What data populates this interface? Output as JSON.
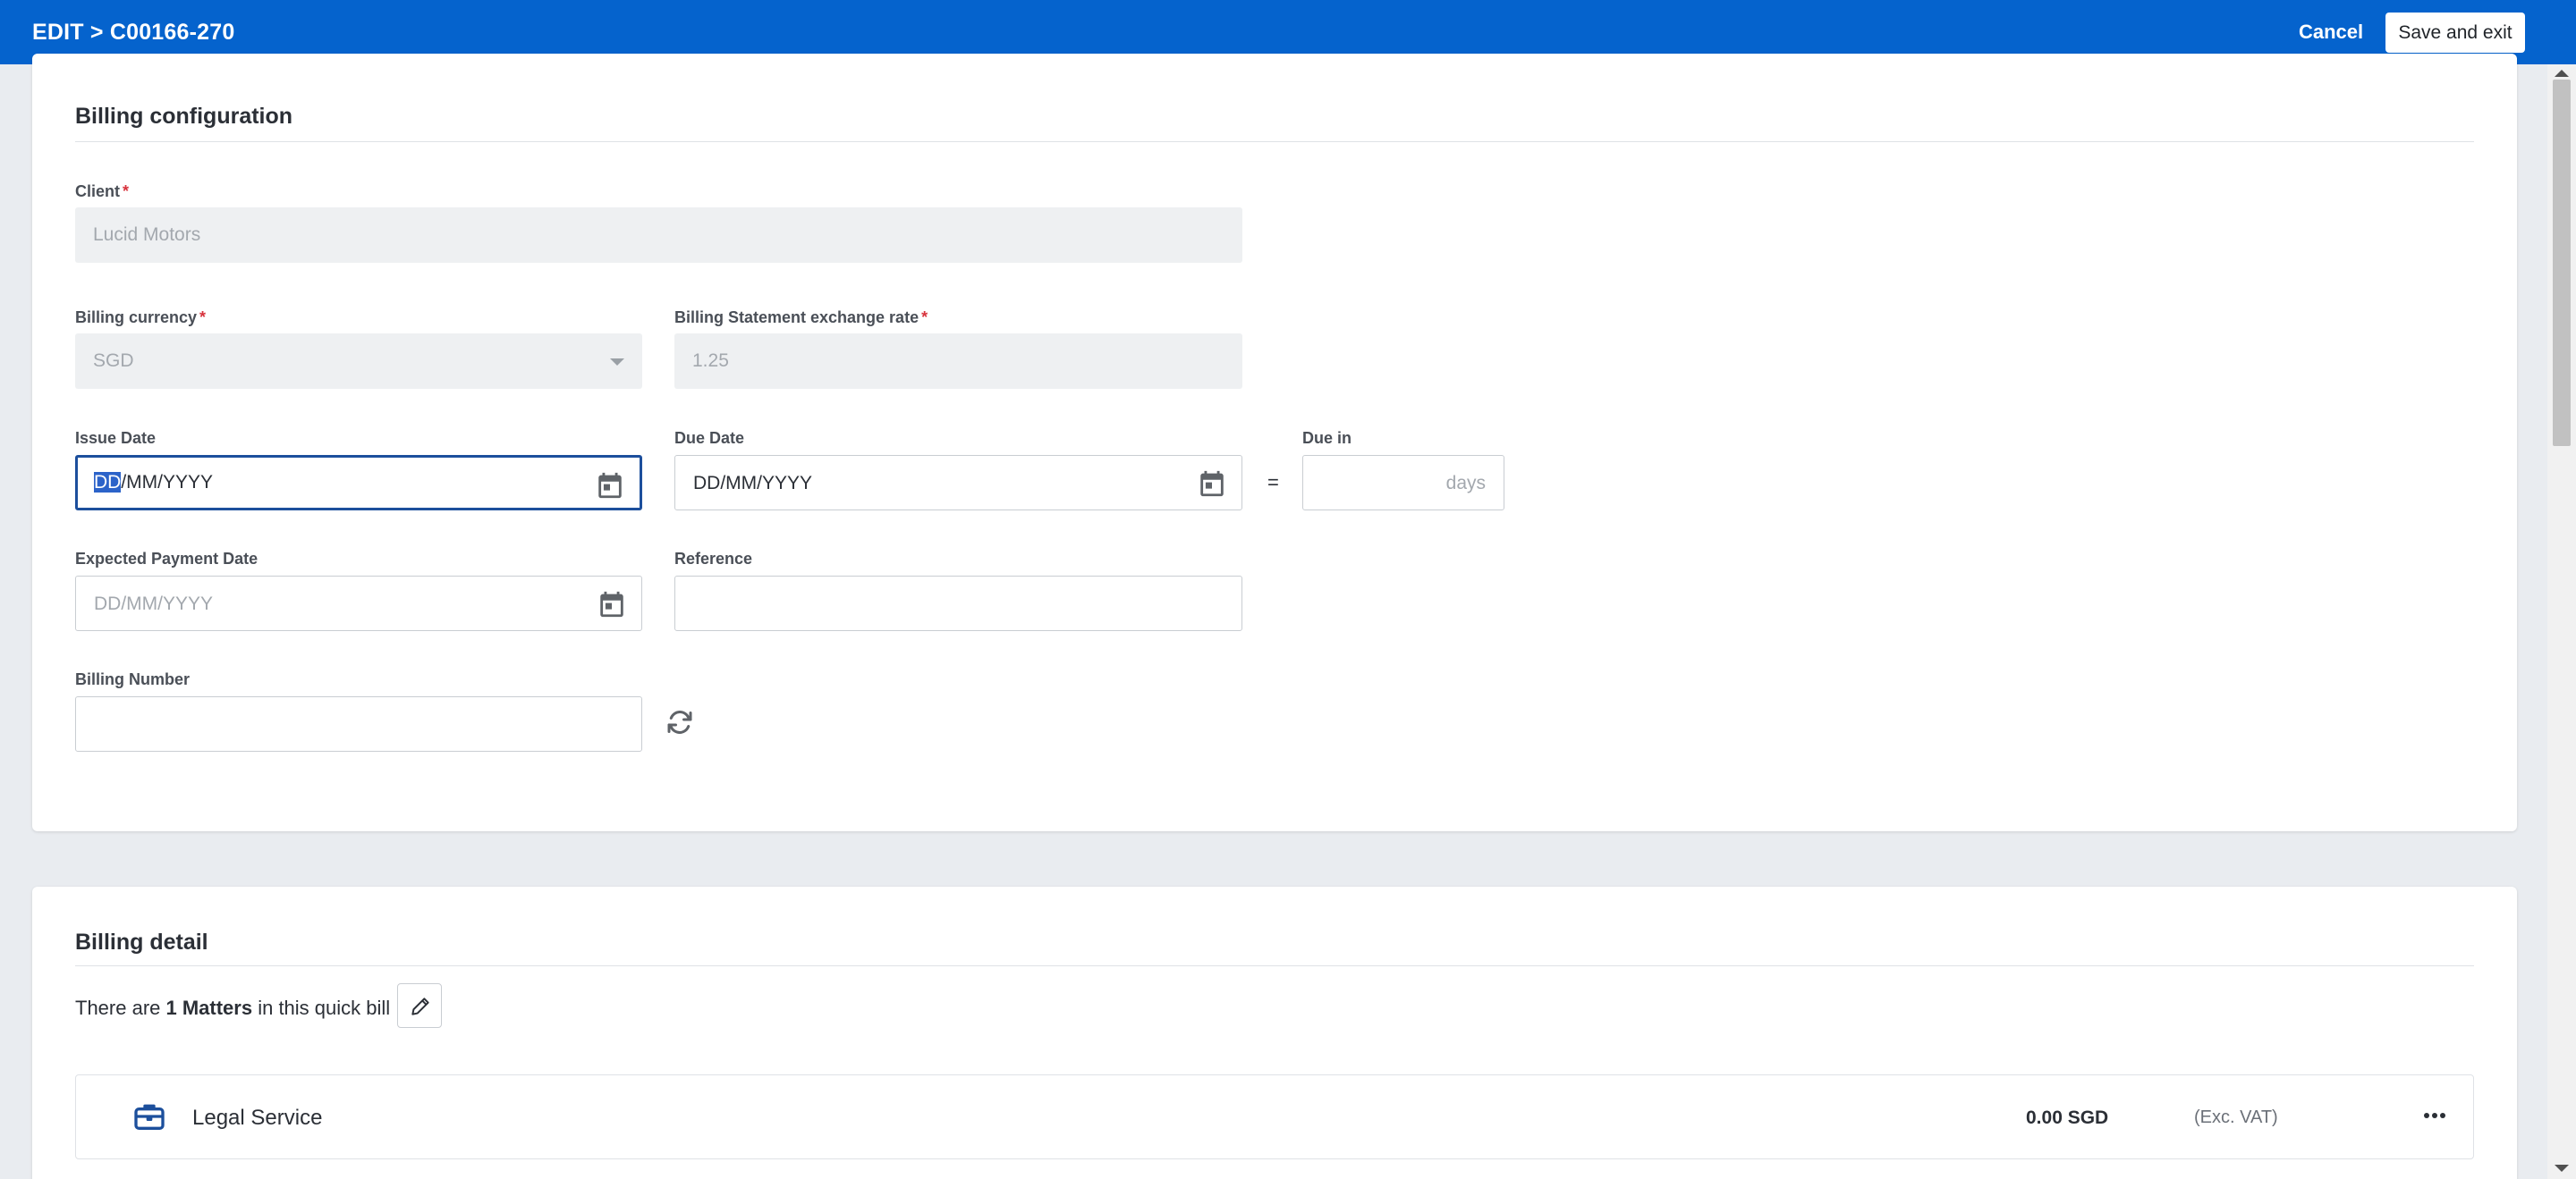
{
  "header": {
    "title": "EDIT > C00166-270",
    "cancel_label": "Cancel",
    "save_label": "Save and exit"
  },
  "billing_configuration": {
    "title": "Billing configuration",
    "client": {
      "label": "Client",
      "value": "Lucid Motors"
    },
    "billing_currency": {
      "label": "Billing currency",
      "value": "SGD"
    },
    "exchange_rate": {
      "label": "Billing Statement exchange rate",
      "value": "1.25"
    },
    "issue_date": {
      "label": "Issue Date",
      "value_selected": "DD",
      "value_rest": "/MM/YYYY"
    },
    "due_date": {
      "label": "Due Date",
      "value": "DD/MM/YYYY"
    },
    "equals": "=",
    "due_in": {
      "label": "Due in",
      "suffix": "days",
      "value": ""
    },
    "expected_payment_date": {
      "label": "Expected Payment Date",
      "placeholder": "DD/MM/YYYY"
    },
    "reference": {
      "label": "Reference",
      "value": ""
    },
    "billing_number": {
      "label": "Billing Number",
      "value": ""
    },
    "required_marker": "*"
  },
  "billing_detail": {
    "title": "Billing detail",
    "matters_prefix": "There are ",
    "matters_count": "1 Matters",
    "matters_suffix": " in this quick bill",
    "matter": {
      "name": "Legal Service",
      "amount": "0.00 SGD",
      "vat_note": "(Exc. VAT)"
    }
  },
  "icons": [
    "calendar-icon",
    "refresh-icon",
    "pencil-icon",
    "briefcase-icon",
    "more-horizontal-icon",
    "chevron-down-icon"
  ],
  "colors": {
    "header_bg": "#0563cd",
    "accent": "#1c4f9c",
    "required": "#d8333d",
    "briefcase": "#1c4f9c"
  }
}
